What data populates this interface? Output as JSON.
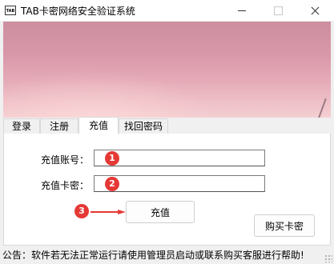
{
  "window": {
    "title": "TAB卡密网络安全验证系统",
    "icon_text": "TAB"
  },
  "tabs": [
    {
      "label": "登录",
      "active": false
    },
    {
      "label": "注册",
      "active": false
    },
    {
      "label": "充值",
      "active": true
    },
    {
      "label": "找回密码",
      "active": false
    }
  ],
  "form": {
    "account_label": "充值账号：",
    "account_value": "",
    "card_label": "充值卡密：",
    "card_value": "",
    "recharge_button": "充值",
    "buy_card_button": "购买卡密"
  },
  "annotations": {
    "step1": "1",
    "step2": "2",
    "step3": "3",
    "color": "#e53935"
  },
  "status": {
    "notice": "公告：软件若无法正常运行请使用管理员启动或联系购买客服进行帮助!"
  }
}
